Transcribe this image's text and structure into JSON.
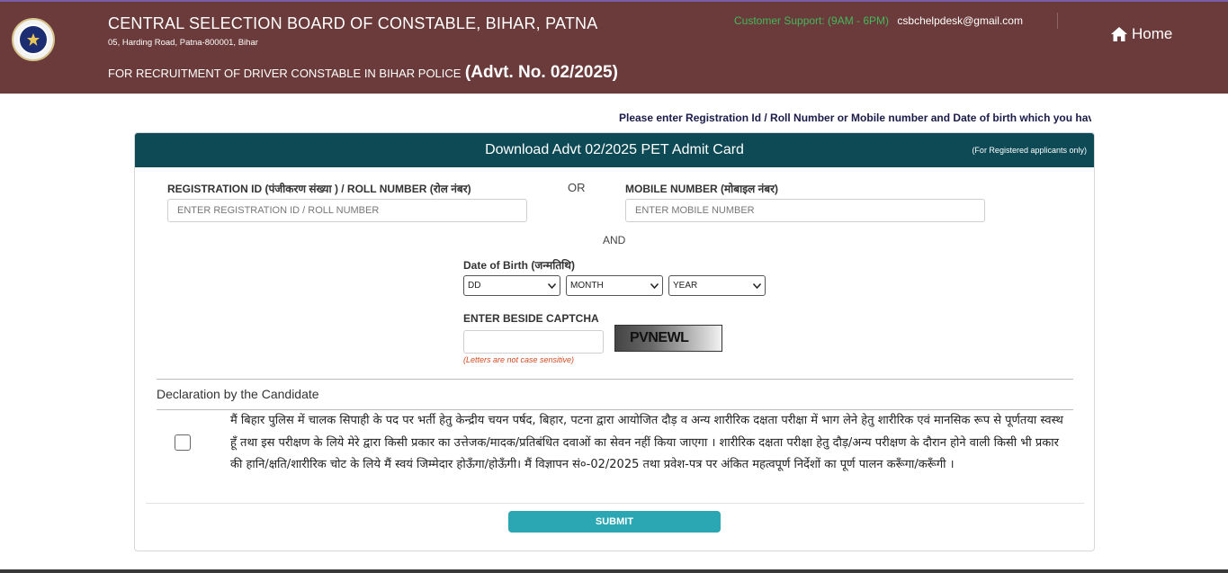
{
  "header": {
    "org_name": "CENTRAL SELECTION BOARD OF CONSTABLE, BIHAR, PATNA",
    "address": "05, Harding Road, Patna-800001, Bihar",
    "recruitment_text": "FOR RECRUITMENT OF DRIVER CONSTABLE IN BIHAR POLICE",
    "advt_text": "(Advt. No. 02/2025)",
    "support_label": "Customer Support: (9AM - 6PM)",
    "support_email": "csbchelpdesk@gmail.com",
    "home_label": "Home",
    "logo_icon": "emblem-icon",
    "bg_color": "#6a3b3a"
  },
  "instruction": "Please enter Registration Id / Roll Number or Mobile number and Date of birth which you hav",
  "card": {
    "title": "Download Advt 02/2025 PET Admit Card",
    "subtitle": "(For Registered applicants only)",
    "header_color": "#0d4a55"
  },
  "form": {
    "reg_label": "REGISTRATION ID (पंजीकरण संख्या ) / ROLL NUMBER (रोल नंबर)",
    "reg_placeholder": "ENTER REGISTRATION ID / ROLL NUMBER",
    "or_text": "OR",
    "mobile_label": "MOBILE NUMBER (मोबाइल नंबर)",
    "mobile_placeholder": "ENTER MOBILE NUMBER",
    "and_text": "AND",
    "dob_label": "Date of Birth (जन्मतिथि)",
    "dob_day": "DD",
    "dob_month": "MONTH",
    "dob_year": "YEAR",
    "captcha_label": "ENTER BESIDE CAPTCHA",
    "captcha_value": "",
    "captcha_text": "PVNEWL",
    "captcha_note": "(Letters are not case sensitive)"
  },
  "declaration": {
    "title": "Declaration by the Candidate",
    "text": "मैं बिहार पुलिस में चालक सिपाही के पद पर भर्ती हेतु केन्द्रीय चयन पर्षद, बिहार, पटना द्वारा आयोजित दौड़ व अन्य शारीरिक दक्षता परीक्षा में भाग लेने हेतु शारीरिक एवं मानसिक रूप से पूर्णतया स्वस्थ हूँ तथा इस परीक्षण के लिये मेरे द्वारा किसी प्रकार का उत्तेजक/मादक/प्रतिबंधित दवाओं का सेवन नहीं किया जाएगा । शारीरिक दक्षता परीक्षा हेतु दौड़/अन्य परीक्षण के दौरान होने वाली किसी भी प्रकार की हानि/क्षति/शारीरिक चोट के लिये मैं स्वयं जिम्मेदार होऊँगा/होऊँगी। मैं विज्ञापन सं०-02/2025 तथा प्रवेश-पत्र पर अंकित महत्वपूर्ण निर्देशों का पूर्ण पालन करूँगा/करूँगी ।"
  },
  "submit_label": "SUBMIT",
  "colors": {
    "accent": "#2aa7b2",
    "support_green": "#43b85b",
    "note_red": "#d14a1f"
  }
}
